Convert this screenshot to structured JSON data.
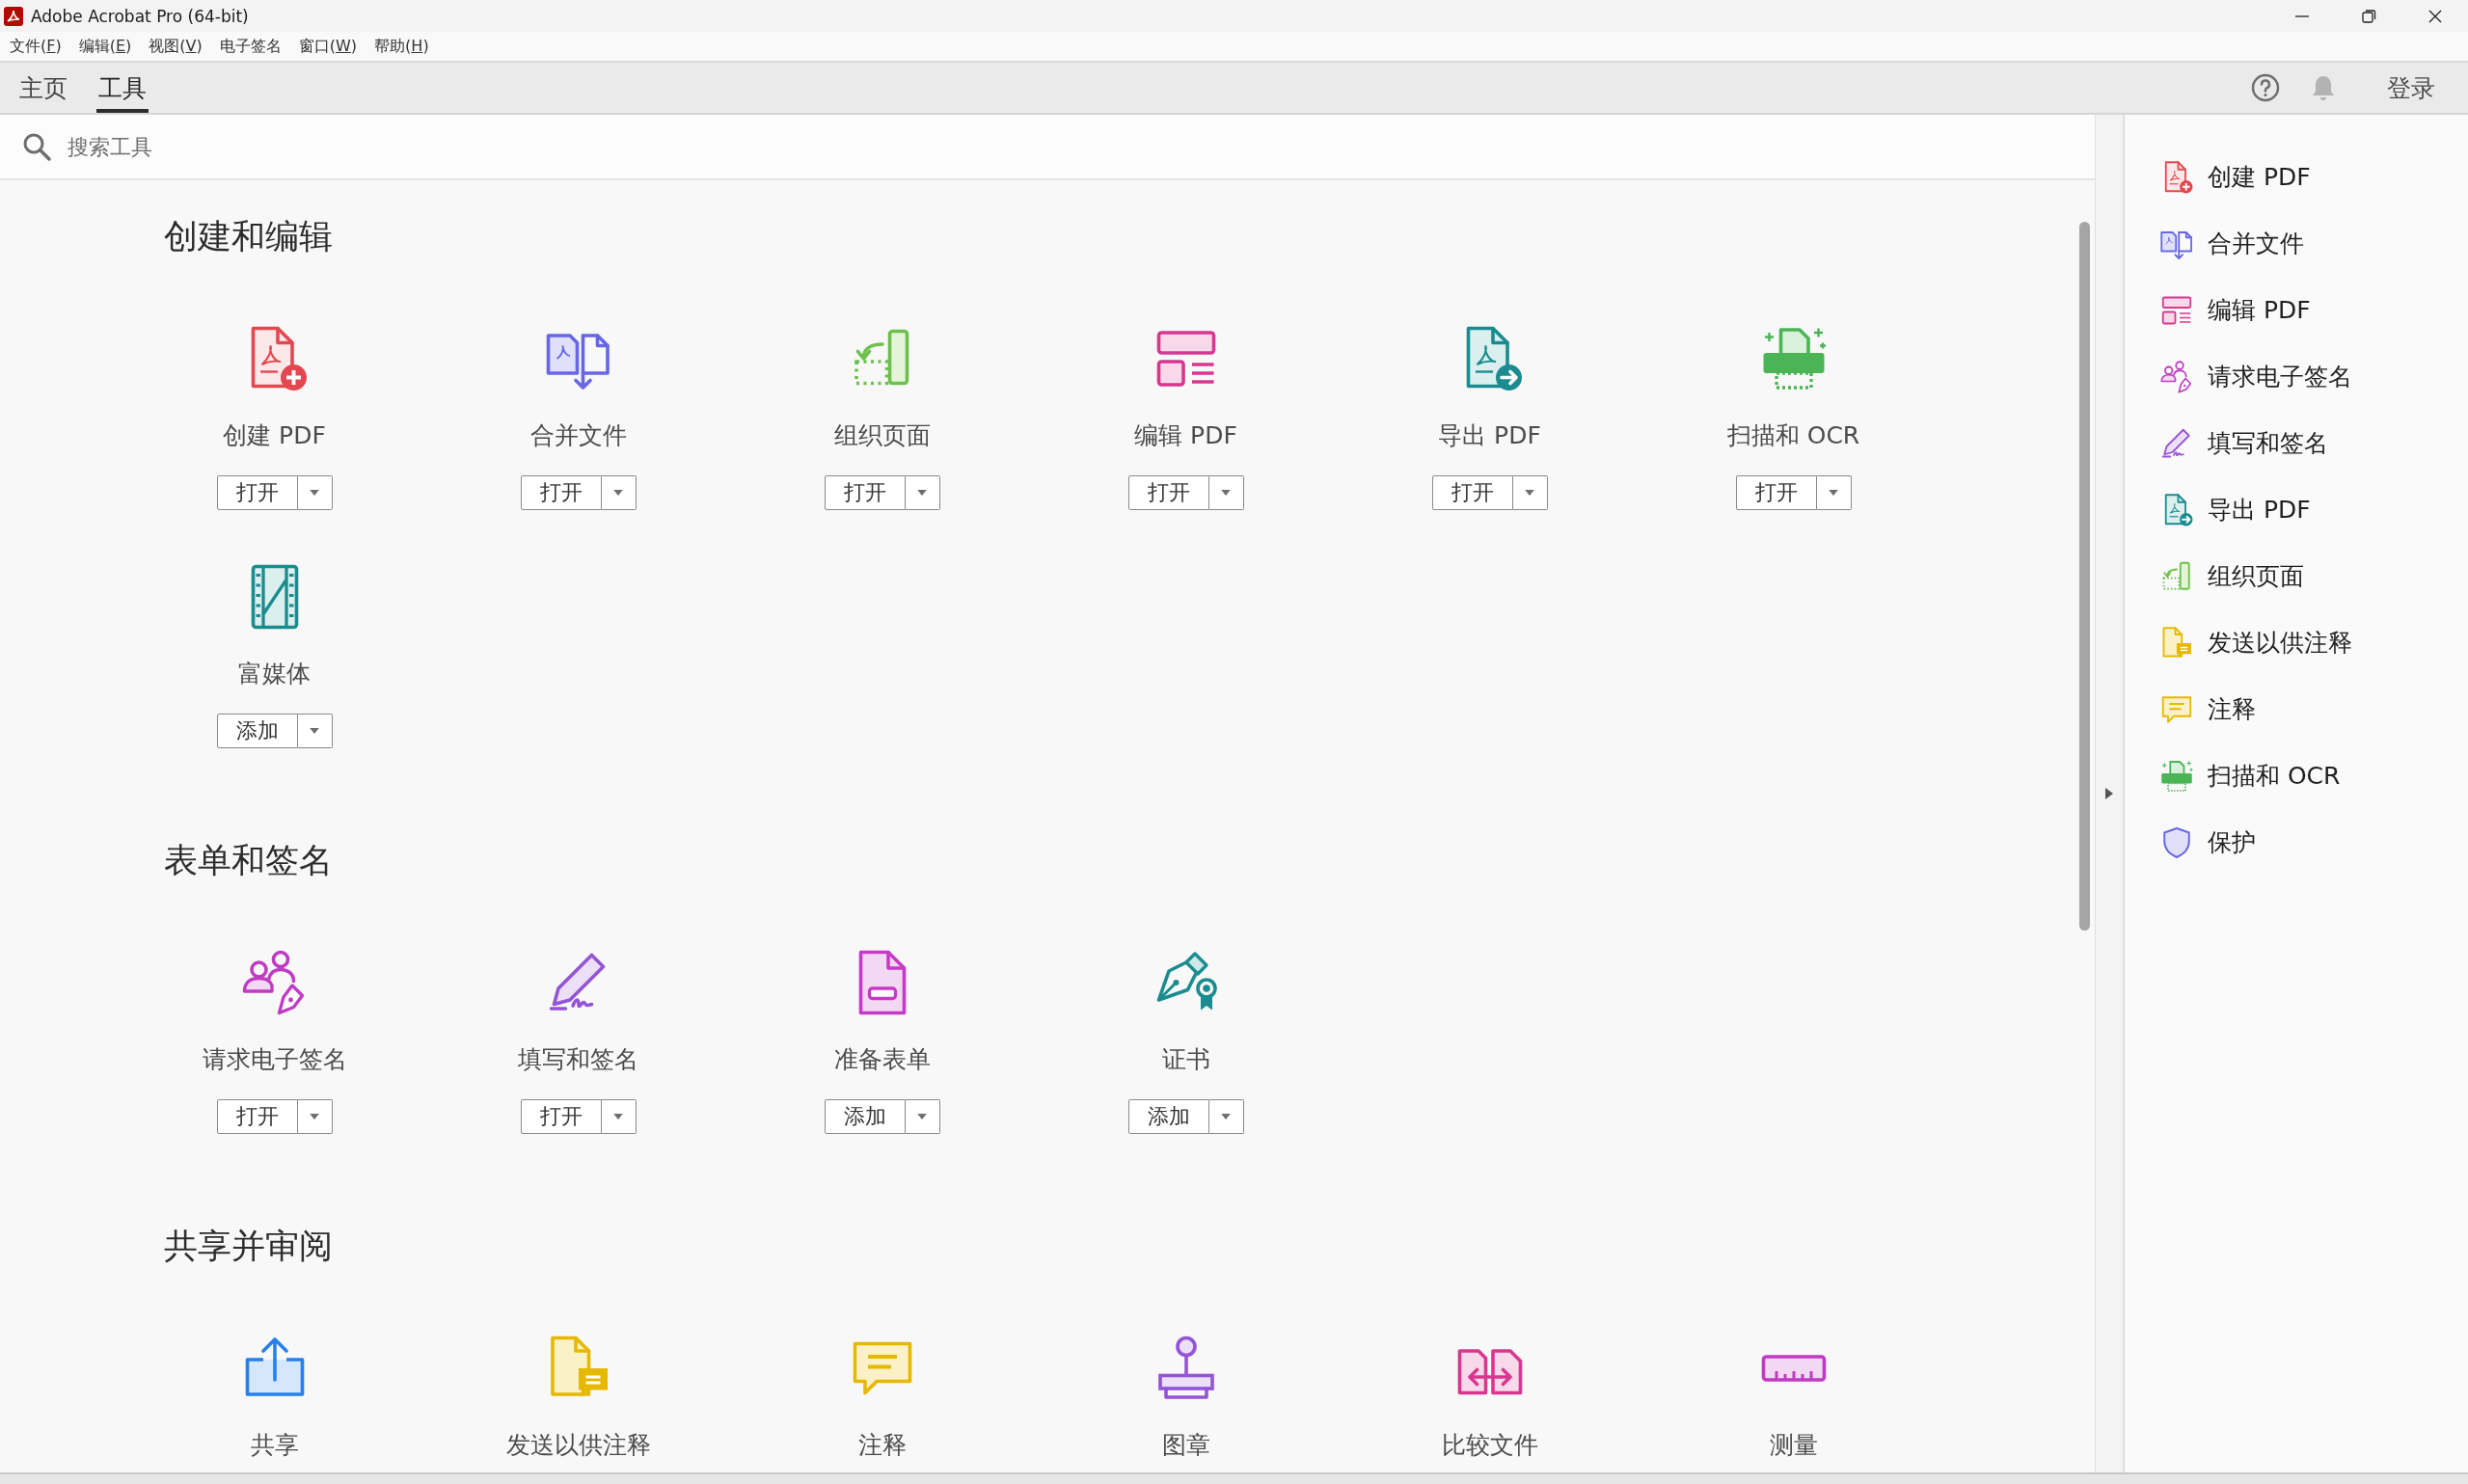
{
  "window": {
    "title": "Adobe Acrobat Pro (64-bit)"
  },
  "menu": [
    {
      "before": "文件(",
      "key": "F",
      "after": ")"
    },
    {
      "before": "编辑(",
      "key": "E",
      "after": ")"
    },
    {
      "before": "视图(",
      "key": "V",
      "after": ")"
    },
    {
      "before": "电子签名"
    },
    {
      "before": "窗口(",
      "key": "W",
      "after": ")"
    },
    {
      "before": "帮助(",
      "key": "H",
      "after": ")"
    }
  ],
  "tabs": [
    {
      "label": "主页",
      "selected": false
    },
    {
      "label": "工具",
      "selected": true
    }
  ],
  "account": {
    "sign_in": "登录"
  },
  "search": {
    "placeholder": "搜索工具"
  },
  "sections": [
    {
      "title": "创建和编辑",
      "tools": [
        {
          "name": "创建 PDF",
          "kind": "create",
          "button": "打开"
        },
        {
          "name": "合并文件",
          "kind": "combine",
          "button": "打开"
        },
        {
          "name": "组织页面",
          "kind": "organize",
          "button": "打开"
        },
        {
          "name": "编辑 PDF",
          "kind": "edit",
          "button": "打开"
        },
        {
          "name": "导出 PDF",
          "kind": "export",
          "button": "打开"
        },
        {
          "name": "扫描和 OCR",
          "kind": "scan",
          "button": "打开"
        },
        {
          "name": "富媒体",
          "kind": "media",
          "button": "添加"
        }
      ]
    },
    {
      "title": "表单和签名",
      "tools": [
        {
          "name": "请求电子签名",
          "kind": "request",
          "button": "打开"
        },
        {
          "name": "填写和签名",
          "kind": "fill",
          "button": "打开"
        },
        {
          "name": "准备表单",
          "kind": "form",
          "button": "添加"
        },
        {
          "name": "证书",
          "kind": "certificate",
          "button": "添加"
        }
      ]
    },
    {
      "title": "共享并审阅",
      "tools": [
        {
          "name": "共享",
          "kind": "share"
        },
        {
          "name": "发送以供注释",
          "kind": "send"
        },
        {
          "name": "注释",
          "kind": "comment"
        },
        {
          "name": "图章",
          "kind": "stamp"
        },
        {
          "name": "比较文件",
          "kind": "compare"
        },
        {
          "name": "测量",
          "kind": "measure"
        }
      ]
    }
  ],
  "sidebar": {
    "items": [
      {
        "label": "创建 PDF",
        "kind": "create"
      },
      {
        "label": "合并文件",
        "kind": "combine"
      },
      {
        "label": "编辑 PDF",
        "kind": "edit"
      },
      {
        "label": "请求电子签名",
        "kind": "request"
      },
      {
        "label": "填写和签名",
        "kind": "fill"
      },
      {
        "label": "导出 PDF",
        "kind": "export"
      },
      {
        "label": "组织页面",
        "kind": "organize"
      },
      {
        "label": "发送以供注释",
        "kind": "send"
      },
      {
        "label": "注释",
        "kind": "comment"
      },
      {
        "label": "扫描和 OCR",
        "kind": "scan"
      },
      {
        "label": "保护",
        "kind": "protect"
      }
    ]
  }
}
